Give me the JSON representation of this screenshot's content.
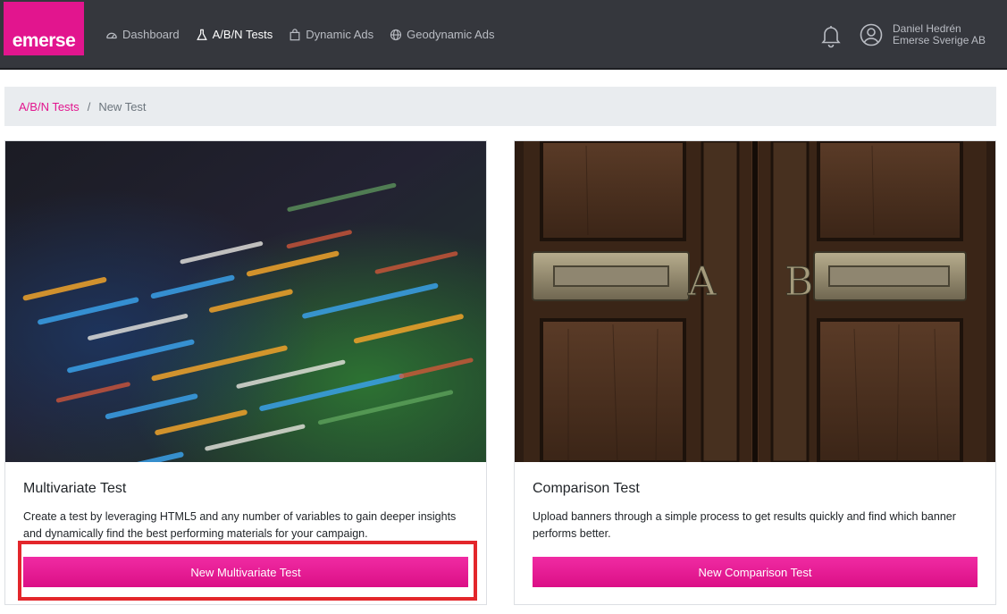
{
  "brand": {
    "logo_text": "emerse",
    "color": "#e2158e"
  },
  "nav": {
    "items": [
      {
        "label": "Dashboard",
        "icon": "dashboard-gauge-icon",
        "active": false
      },
      {
        "label": "A/B/N Tests",
        "icon": "flask-icon",
        "active": true
      },
      {
        "label": "Dynamic Ads",
        "icon": "shopping-bag-icon",
        "active": false
      },
      {
        "label": "Geodynamic Ads",
        "icon": "globe-icon",
        "active": false
      }
    ]
  },
  "user": {
    "name": "Daniel Hedrén",
    "company": "Emerse Sverige AB",
    "icons": [
      "bell-icon",
      "user-circle-icon"
    ]
  },
  "breadcrumb": {
    "parent": "A/B/N Tests",
    "separator": "/",
    "current": "New Test"
  },
  "cards": [
    {
      "image": "code-screen-photo",
      "title": "Multivariate Test",
      "text": "Create a test by leveraging HTML5 and any number of variables to gain deeper insights and dynamically find the best performing materials for your campaign.",
      "button": "New Multivariate Test"
    },
    {
      "image": "ab-wooden-doors-photo",
      "title": "Comparison Test",
      "text": "Upload banners through a simple process to get results quickly and find which banner performs better.",
      "button": "New Comparison Test"
    }
  ],
  "colors": {
    "accent": "#e2158e",
    "navbar": "#35373d",
    "highlight": "#e3262b"
  }
}
